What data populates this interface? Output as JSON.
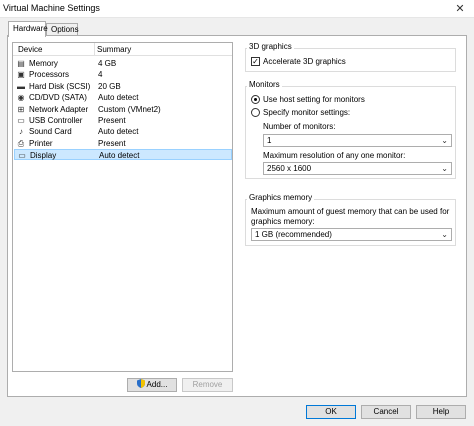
{
  "window": {
    "title": "Virtual Machine Settings",
    "close_glyph": "✕"
  },
  "tabs": [
    {
      "label": "Hardware",
      "active": true
    },
    {
      "label": "Options",
      "active": false
    }
  ],
  "device_list": {
    "columns": {
      "device": "Device",
      "summary": "Summary"
    },
    "rows": [
      {
        "device": "Memory",
        "summary": "4 GB",
        "icon": "memory-icon",
        "glyph": "▤"
      },
      {
        "device": "Processors",
        "summary": "4",
        "icon": "processor-icon",
        "glyph": "▣"
      },
      {
        "device": "Hard Disk (SCSI)",
        "summary": "20 GB",
        "icon": "hard-disk-icon",
        "glyph": "▬"
      },
      {
        "device": "CD/DVD (SATA)",
        "summary": "Auto detect",
        "icon": "cd-dvd-icon",
        "glyph": "◉"
      },
      {
        "device": "Network Adapter",
        "summary": "Custom (VMnet2)",
        "icon": "network-adapter-icon",
        "glyph": "⊞"
      },
      {
        "device": "USB Controller",
        "summary": "Present",
        "icon": "usb-icon",
        "glyph": "▭"
      },
      {
        "device": "Sound Card",
        "summary": "Auto detect",
        "icon": "sound-card-icon",
        "glyph": "♪"
      },
      {
        "device": "Printer",
        "summary": "Present",
        "icon": "printer-icon",
        "glyph": "⎙"
      },
      {
        "device": "Display",
        "summary": "Auto detect",
        "icon": "display-icon",
        "glyph": "▭",
        "selected": true
      }
    ]
  },
  "add_button": "Add...",
  "remove_button": "Remove",
  "graphics_3d": {
    "title": "3D graphics",
    "accelerate_label": "Accelerate 3D graphics",
    "accelerate_checked": true
  },
  "monitors": {
    "title": "Monitors",
    "use_host_label": "Use host setting for monitors",
    "specify_label": "Specify monitor settings:",
    "selected": "use_host",
    "number_label": "Number of monitors:",
    "number_value": "1",
    "max_res_label": "Maximum resolution of any one monitor:",
    "max_res_value": "2560 x 1600"
  },
  "graphics_memory": {
    "title": "Graphics memory",
    "description": "Maximum amount of guest memory that can be used for graphics memory:",
    "value": "1 GB (recommended)"
  },
  "footer": {
    "ok": "OK",
    "cancel": "Cancel",
    "help": "Help"
  },
  "colors": {
    "selection_bg": "#cce8ff",
    "selection_border": "#99d1ff",
    "primary_border": "#0078d7"
  },
  "dropdown_arrow": "⌄"
}
